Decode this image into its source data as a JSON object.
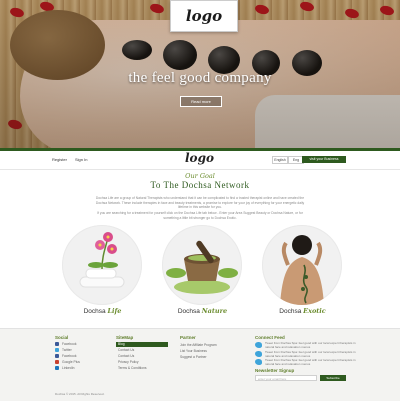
{
  "hero": {
    "logo": "logo",
    "tagline": "the feel good company",
    "cta": "Read more"
  },
  "nav": {
    "links": [
      "Register",
      "Sign In"
    ],
    "logo": "logo",
    "lang": [
      "English",
      "Eng"
    ],
    "visit_button": "visit your Business"
  },
  "intro": {
    "subtitle": "Our Goal",
    "title": "To The Dochsa Network",
    "paragraph1": "Dochsa Life are a group of Natural Therapists who understand that it can be complicated to find a trusted therapist online and have created the Dochsa Network. These include therapies in face and beauty treatments, a promise to explore for your joy of everything for your energetic daily lifetime in this website for you.",
    "paragraph2": "If you are searching for a treatment for yourself click on the Dochsa Life tab below - Enter your Area Suggest Beauty or Dochsa Nature, or for something a little bit stronger go to Dochsa Exotic."
  },
  "features": [
    {
      "brand": "Dochsa",
      "suffix": "Life"
    },
    {
      "brand": "Dochsa",
      "suffix": "Nature"
    },
    {
      "brand": "Dochsa",
      "suffix": "Exotic"
    }
  ],
  "footer": {
    "social": {
      "title": "Social",
      "items": [
        {
          "label": "Facebook",
          "color": "#3b5998"
        },
        {
          "label": "Twitter",
          "color": "#3ea4da"
        },
        {
          "label": "Facebook",
          "color": "#3b5998"
        },
        {
          "label": "Google Plus",
          "color": "#c8412f"
        },
        {
          "label": "LinkedIn",
          "color": "#1b75bb"
        }
      ]
    },
    "sitemap": {
      "title": "SiteMap",
      "items": [
        "Blog",
        "Contact Us",
        "Contact Us",
        "Privacy Policy",
        "Terms & Conditions"
      ]
    },
    "partner": {
      "title": "Partner",
      "items": [
        "Join the Affiliate Program",
        "List Your Business",
        "Suggest a Partner"
      ]
    },
    "connect": {
      "title": "Connect Feed",
      "tweets": [
        {
          "text": "Tweet from Dochsa Spa: feel good with our local expert therapists in natural face and relaxation menus"
        },
        {
          "text": "Tweet from Dochsa Spa: feel good with our local expert therapists in natural face and relaxation menus"
        },
        {
          "text": "Tweet from Dochsa Spa: feel good with our local expert therapists in natural face and relaxation menus"
        }
      ]
    },
    "newsletter": {
      "title": "Newsletter Signup",
      "placeholder": "enter your email here",
      "button": "Subscribe"
    },
    "copyright": "Dochsa © 2015. All Rights Reserved."
  },
  "colors": {
    "accent": "#2e5a1f",
    "accent_light": "#6b8c2e",
    "petal": "#b3141c"
  }
}
